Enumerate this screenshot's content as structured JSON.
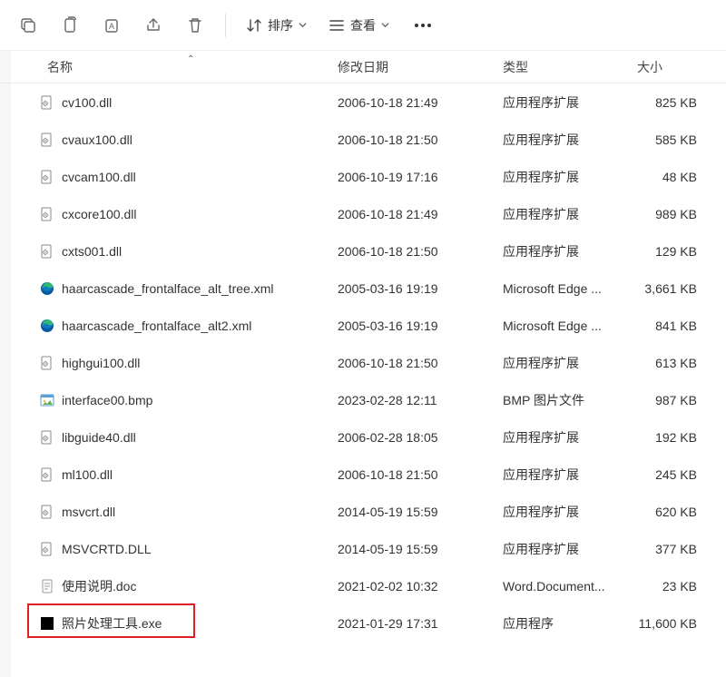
{
  "toolbar": {
    "sort_label": "排序",
    "view_label": "查看"
  },
  "columns": {
    "name": "名称",
    "modified": "修改日期",
    "type": "类型",
    "size": "大小"
  },
  "files": [
    {
      "icon": "dll",
      "name": "cv100.dll",
      "modified": "2006-10-18 21:49",
      "type": "应用程序扩展",
      "size": "825 KB"
    },
    {
      "icon": "dll",
      "name": "cvaux100.dll",
      "modified": "2006-10-18 21:50",
      "type": "应用程序扩展",
      "size": "585 KB"
    },
    {
      "icon": "dll",
      "name": "cvcam100.dll",
      "modified": "2006-10-19 17:16",
      "type": "应用程序扩展",
      "size": "48 KB"
    },
    {
      "icon": "dll",
      "name": "cxcore100.dll",
      "modified": "2006-10-18 21:49",
      "type": "应用程序扩展",
      "size": "989 KB"
    },
    {
      "icon": "dll",
      "name": "cxts001.dll",
      "modified": "2006-10-18 21:50",
      "type": "应用程序扩展",
      "size": "129 KB"
    },
    {
      "icon": "edge",
      "name": "haarcascade_frontalface_alt_tree.xml",
      "modified": "2005-03-16 19:19",
      "type": "Microsoft Edge ...",
      "size": "3,661 KB"
    },
    {
      "icon": "edge",
      "name": "haarcascade_frontalface_alt2.xml",
      "modified": "2005-03-16 19:19",
      "type": "Microsoft Edge ...",
      "size": "841 KB"
    },
    {
      "icon": "dll",
      "name": "highgui100.dll",
      "modified": "2006-10-18 21:50",
      "type": "应用程序扩展",
      "size": "613 KB"
    },
    {
      "icon": "bmp",
      "name": "interface00.bmp",
      "modified": "2023-02-28 12:11",
      "type": "BMP 图片文件",
      "size": "987 KB"
    },
    {
      "icon": "dll",
      "name": "libguide40.dll",
      "modified": "2006-02-28 18:05",
      "type": "应用程序扩展",
      "size": "192 KB"
    },
    {
      "icon": "dll",
      "name": "ml100.dll",
      "modified": "2006-10-18 21:50",
      "type": "应用程序扩展",
      "size": "245 KB"
    },
    {
      "icon": "dll",
      "name": "msvcrt.dll",
      "modified": "2014-05-19 15:59",
      "type": "应用程序扩展",
      "size": "620 KB"
    },
    {
      "icon": "dll",
      "name": "MSVCRTD.DLL",
      "modified": "2014-05-19 15:59",
      "type": "应用程序扩展",
      "size": "377 KB"
    },
    {
      "icon": "doc",
      "name": "使用说明.doc",
      "modified": "2021-02-02 10:32",
      "type": "Word.Document...",
      "size": "23 KB"
    },
    {
      "icon": "exe",
      "name": "照片处理工具.exe",
      "modified": "2021-01-29 17:31",
      "type": "应用程序",
      "size": "11,600 KB",
      "highlight": true
    }
  ]
}
